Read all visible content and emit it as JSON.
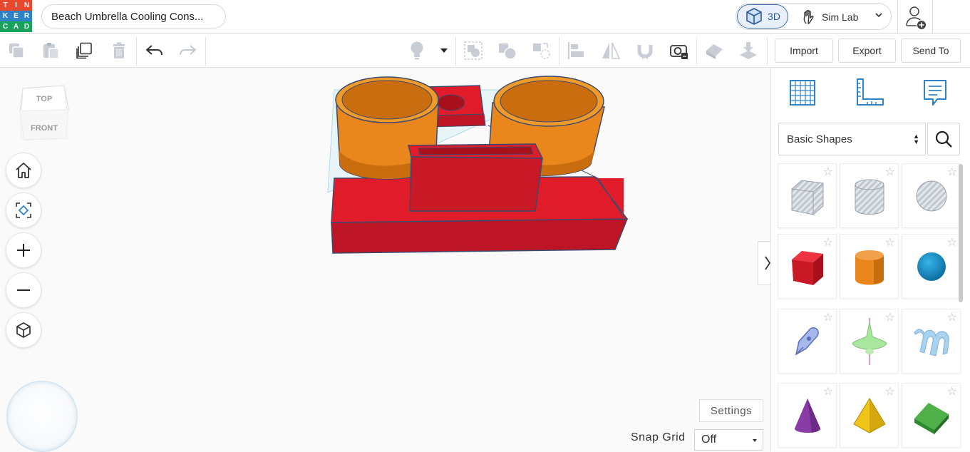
{
  "app": {
    "logo_letters": [
      "T",
      "I",
      "N",
      "K",
      "E",
      "R",
      "C",
      "A",
      "D"
    ],
    "logo_colors": [
      "#e8482c",
      "#e8482c",
      "#e8482c",
      "#2e83c6",
      "#2e83c6",
      "#2e83c6",
      "#18a25b",
      "#18a25b",
      "#18a25b"
    ],
    "design_title": "Beach Umbrella Cooling Cons..."
  },
  "mode_switch": {
    "mode_3d_label": "3D",
    "sim_lab_label": "Sim Lab",
    "icons": {
      "mode_3d": "cube-icon",
      "sim_lab": "hand-lab-icon",
      "dropdown": "chevron-down-icon"
    }
  },
  "account": {
    "icon": "user-add-icon"
  },
  "toolbar": {
    "left_tools": [
      {
        "name": "copy-button",
        "icon": "copy-icon",
        "enabled": false
      },
      {
        "name": "paste-button",
        "icon": "paste-icon",
        "enabled": false
      },
      {
        "name": "duplicate-button",
        "icon": "duplicate-icon",
        "enabled": true
      },
      {
        "name": "delete-button",
        "icon": "trash-icon",
        "enabled": false
      },
      {
        "name": "undo-button",
        "icon": "undo-icon",
        "enabled": true
      },
      {
        "name": "redo-button",
        "icon": "redo-icon",
        "enabled": false
      }
    ],
    "right_tools": [
      {
        "name": "light-button",
        "icon": "lightbulb-icon"
      },
      {
        "name": "light-dropdown",
        "icon": "caret-down-icon"
      },
      {
        "name": "group-button",
        "icon": "group-icon"
      },
      {
        "name": "ungroup-button",
        "icon": "ungroup-icon"
      },
      {
        "name": "workplane-shape-button",
        "icon": "shape-workplane-icon"
      },
      {
        "name": "align-button",
        "icon": "align-icon"
      },
      {
        "name": "mirror-button",
        "icon": "mirror-icon"
      },
      {
        "name": "magnet-button",
        "icon": "magnet-icon"
      },
      {
        "name": "ruler-button",
        "icon": "ruler-camera-icon"
      },
      {
        "name": "hide-button",
        "icon": "eraser-icon"
      },
      {
        "name": "drop-button",
        "icon": "drop-icon"
      }
    ],
    "import_label": "Import",
    "export_label": "Export",
    "send_to_label": "Send To"
  },
  "viewcube": {
    "top_label": "TOP",
    "front_label": "FRONT"
  },
  "view_controls": [
    {
      "name": "home-view-button",
      "icon": "home-icon"
    },
    {
      "name": "fit-view-button",
      "icon": "fit-view-icon"
    },
    {
      "name": "zoom-in-button",
      "icon": "plus-icon"
    },
    {
      "name": "zoom-out-button",
      "icon": "minus-icon"
    },
    {
      "name": "projection-button",
      "icon": "perspective-cube-icon"
    }
  ],
  "workplane": {
    "settings_label": "Settings",
    "snap_grid_label": "Snap Grid",
    "snap_grid_value": "Off"
  },
  "scene_colors": {
    "red": "#e01c2a",
    "orange": "#e9861c",
    "outline": "#3c4a6e"
  },
  "right_panel": {
    "tabs": [
      {
        "name": "tab-workplane",
        "icon": "grid-workplane-icon"
      },
      {
        "name": "tab-ruler",
        "icon": "ruler-icon"
      },
      {
        "name": "tab-notes",
        "icon": "notes-icon"
      }
    ],
    "library_select": "Basic Shapes",
    "search_icon": "search-icon",
    "collapse_icon": "chevron-right-icon",
    "shapes": [
      {
        "name": "box-hole",
        "icon": "box-hole-icon"
      },
      {
        "name": "cylinder-hole",
        "icon": "cylinder-hole-icon"
      },
      {
        "name": "sphere-hole",
        "icon": "sphere-hole-icon"
      },
      {
        "name": "box",
        "icon": "box-icon",
        "color": "#e01c2a"
      },
      {
        "name": "cylinder",
        "icon": "cylinder-icon",
        "color": "#e9861c"
      },
      {
        "name": "sphere",
        "icon": "sphere-icon",
        "color": "#1c8fc9"
      },
      {
        "name": "scribble",
        "icon": "scribble-icon",
        "color": "#8da3e0"
      },
      {
        "name": "shape-generator",
        "icon": "spinning-top-icon",
        "color": "#9fe29a"
      },
      {
        "name": "text-shape",
        "icon": "text-3d-icon",
        "color": "#9cc8ea"
      },
      {
        "name": "cone",
        "icon": "cone-icon",
        "color": "#8a3ca6"
      },
      {
        "name": "pyramid",
        "icon": "pyramid-icon",
        "color": "#f0c419"
      },
      {
        "name": "roof",
        "icon": "roof-icon",
        "color": "#3d9a3d"
      }
    ]
  }
}
